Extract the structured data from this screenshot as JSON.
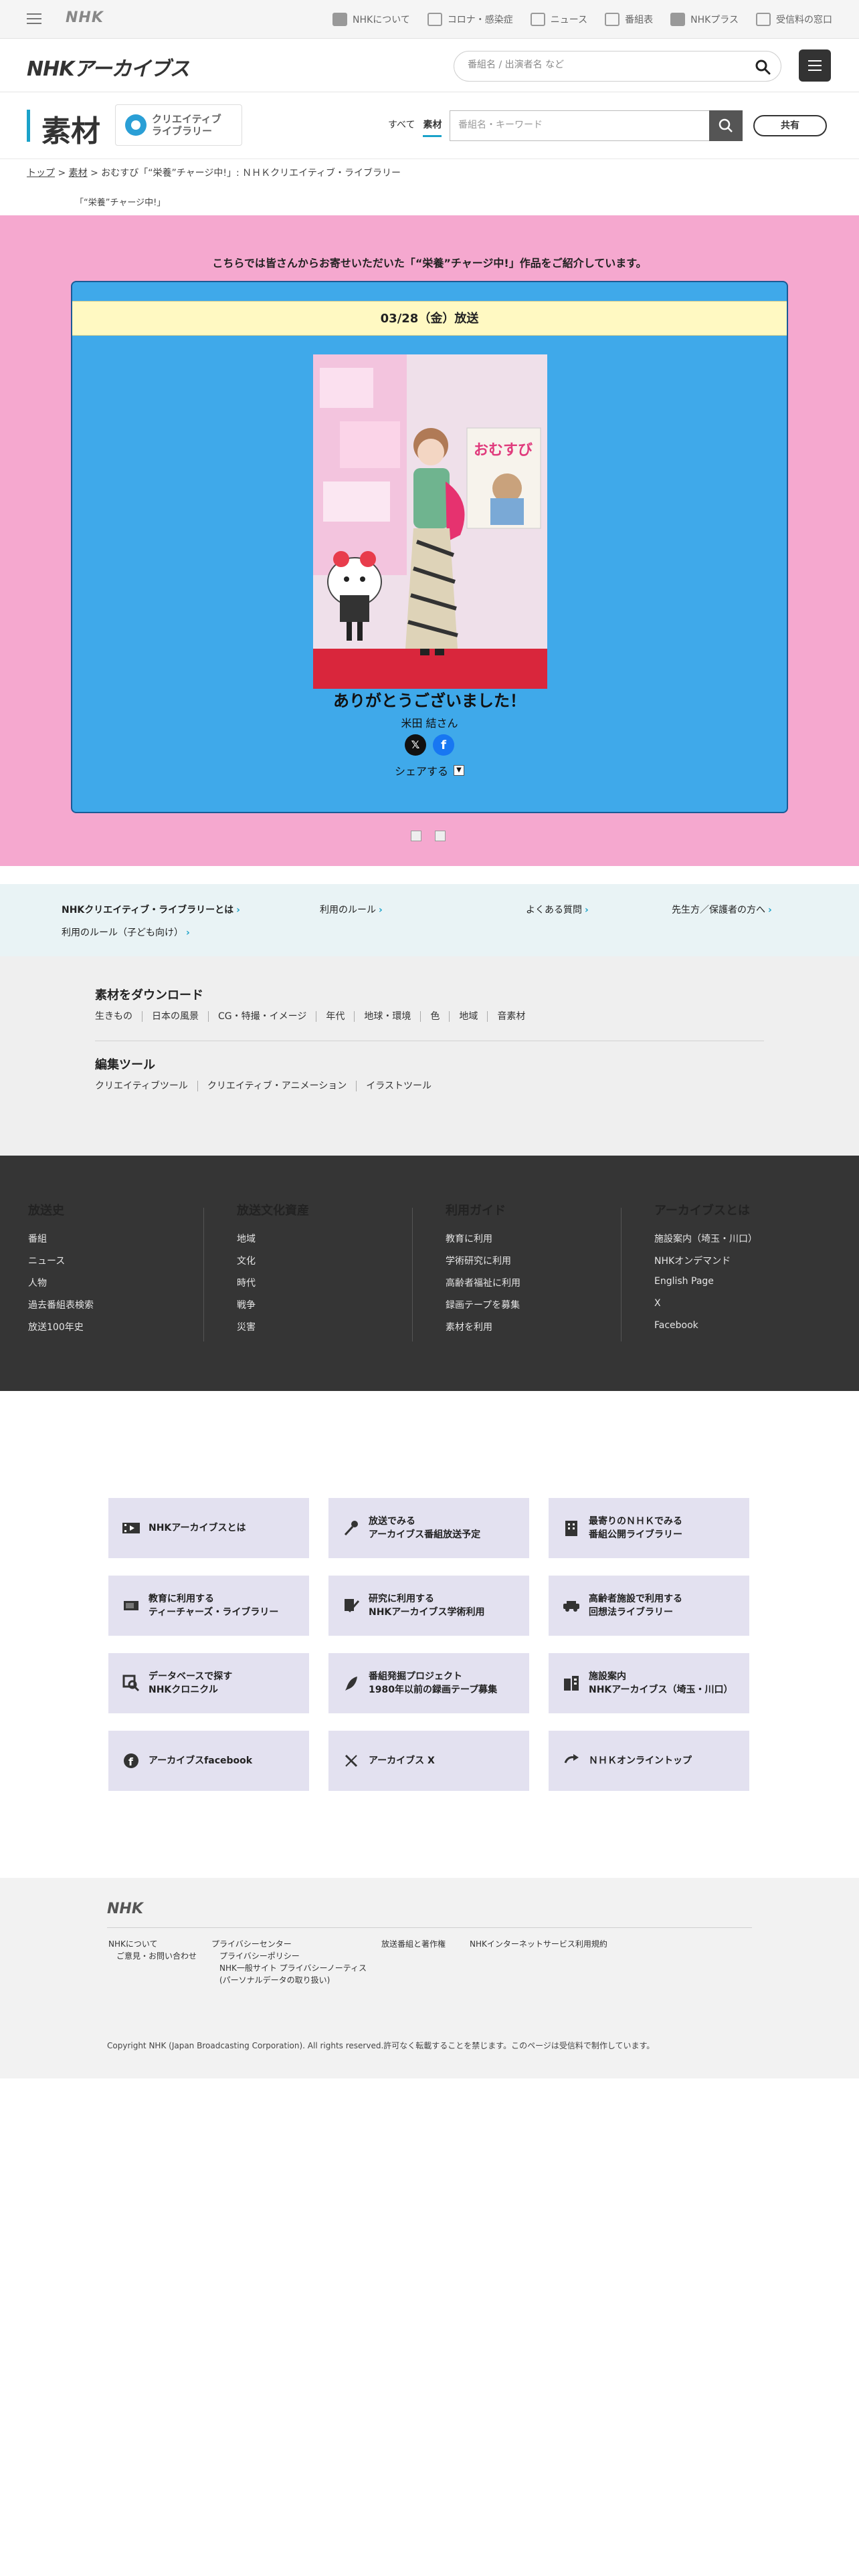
{
  "topbar": {
    "brand": "NHK",
    "items": [
      {
        "icon": "nhk-info-icon",
        "label": "NHKについて"
      },
      {
        "icon": "corona-icon",
        "label": "コロナ・感染症"
      },
      {
        "icon": "news-icon",
        "label": "ニュース"
      },
      {
        "icon": "program-table-icon",
        "label": "番組表"
      },
      {
        "icon": "nhk-plus-icon",
        "label": "NHKプラス"
      },
      {
        "icon": "reception-icon",
        "label": "受信料の窓口"
      }
    ]
  },
  "header": {
    "logo": "NHKアーカイブス",
    "search_placeholder": "番組名 / 出演者名 など"
  },
  "section": {
    "title": "素材",
    "badge_line1": "クリエイティブ",
    "badge_line2": "ライブラリー",
    "tabs": [
      "すべて",
      "素材"
    ],
    "search_placeholder": "番組名・キーワード",
    "share_label": "共有"
  },
  "breadcrumb": {
    "items": [
      "トップ",
      "素材",
      "おむすび「“栄養”チャージ中!」: ＮＨＫクリエイティブ・ライブラリー"
    ],
    "sep": ">"
  },
  "page_sub": "「“栄養”チャージ中!」",
  "feature": {
    "intro": "こちらでは皆さんからお寄せいただいた「“栄養”チャージ中!」作品をご紹介しています。",
    "date": "03/28（金）放送",
    "photo_overlay_text": "おむすび",
    "thanks": "ありがとうございました！",
    "person": "米田 結さん",
    "share_label": "シェアする",
    "toggle": "▼"
  },
  "info_links": [
    "NHKクリエイティブ・ライブラリーとは",
    "利用のルール",
    "よくある質問",
    "先生方／保護者の方へ",
    "利用のルール（子ども向け）"
  ],
  "download": {
    "heading": "素材をダウンロード",
    "items": [
      "生きもの",
      "日本の風景",
      "CG・特撮・イメージ",
      "年代",
      "地球・環境",
      "色",
      "地域",
      "音素材"
    ],
    "tools_heading": "編集ツール",
    "tools": [
      "クリエイティブツール",
      "クリエイティブ・アニメーション",
      "イラストツール"
    ]
  },
  "dark_footer": {
    "columns": [
      {
        "heading": "放送史",
        "items": [
          "番組",
          "ニュース",
          "人物",
          "過去番組表検索",
          "放送100年史"
        ]
      },
      {
        "heading": "放送文化資産",
        "items": [
          "地域",
          "文化",
          "時代",
          "戦争",
          "災害"
        ]
      },
      {
        "heading": "利用ガイド",
        "items": [
          "教育に利用",
          "学術研究に利用",
          "高齢者福祉に利用",
          "録画テープを募集",
          "素材を利用"
        ]
      },
      {
        "heading": "アーカイブスとは",
        "items": [
          "施設案内（埼玉・川口）",
          "NHKオンデマンド",
          "English Page",
          "X",
          "Facebook"
        ]
      }
    ]
  },
  "tiles": [
    {
      "icon": "film-icon",
      "text": "NHKアーカイブスとは"
    },
    {
      "icon": "microphone-icon",
      "text": "放送でみる\nアーカイブス番組放送予定"
    },
    {
      "icon": "building-icon",
      "text": "最寄りのＮＨＫでみる\n番組公開ライブラリー"
    },
    {
      "icon": "tv-icon",
      "text": "教育に利用する\nティーチャーズ・ライブラリー"
    },
    {
      "icon": "pen-icon",
      "text": "研究に利用する\nNHKアーカイブス学術利用"
    },
    {
      "icon": "car-icon",
      "text": "高齢者施設で利用する\n回想法ライブラリー"
    },
    {
      "icon": "database-search-icon",
      "text": "データベースで探す\nNHKクロニクル"
    },
    {
      "icon": "quill-icon",
      "text": "番組発掘プロジェクト\n1980年以前の録画テープ募集"
    },
    {
      "icon": "facility-icon",
      "text": "施設案内\nNHKアーカイブス（埼玉・川口）"
    },
    {
      "icon": "facebook-icon",
      "text": "アーカイブスfacebook"
    },
    {
      "icon": "x-icon",
      "text": "アーカイブス X"
    },
    {
      "icon": "return-arrow-icon",
      "text": "ＮＨＫオンライントップ"
    }
  ],
  "bottom_footer": {
    "brand": "NHK",
    "links": [
      "NHKについて\n　ご意見・お問い合わせ",
      "プライバシーセンター\n　プライバシーポリシー\n　NHK一般サイト プライバシーノーティス\n　(パーソナルデータの取り扱い)",
      "放送番組と著作権",
      "NHKインターネットサービス利用規約"
    ],
    "copyright": "Copyright NHK (Japan Broadcasting Corporation). All rights reserved.許可なく転載することを禁じます。このページは受信料で制作しています。"
  }
}
